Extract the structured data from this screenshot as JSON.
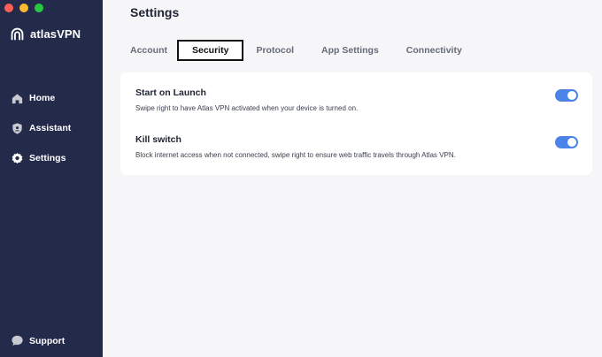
{
  "window": {
    "controls": [
      "close",
      "minimize",
      "zoom"
    ]
  },
  "sidebar": {
    "brand": "atlasVPN",
    "items": [
      {
        "label": "Home",
        "icon": "home-icon",
        "active": false
      },
      {
        "label": "Assistant",
        "icon": "shield-icon",
        "active": false
      },
      {
        "label": "Settings",
        "icon": "gear-icon",
        "active": true
      }
    ],
    "support": {
      "label": "Support",
      "icon": "chat-icon"
    }
  },
  "main": {
    "title": "Settings",
    "tabs": [
      {
        "label": "Account",
        "active": false
      },
      {
        "label": "Security",
        "active": true
      },
      {
        "label": "Protocol",
        "active": false
      },
      {
        "label": "App Settings",
        "active": false
      },
      {
        "label": "Connectivity",
        "active": false
      }
    ],
    "settings": [
      {
        "title": "Start on Launch",
        "description": "Swipe right to have Atlas VPN activated when your device is turned on.",
        "enabled": true
      },
      {
        "title": "Kill switch",
        "description": "Block internet access when not connected, swipe right to ensure web traffic travels through Atlas VPN.",
        "enabled": true
      }
    ]
  },
  "colors": {
    "sidebar_bg": "#242b4a",
    "accent": "#4b84e8",
    "main_bg": "#f6f6f8"
  }
}
